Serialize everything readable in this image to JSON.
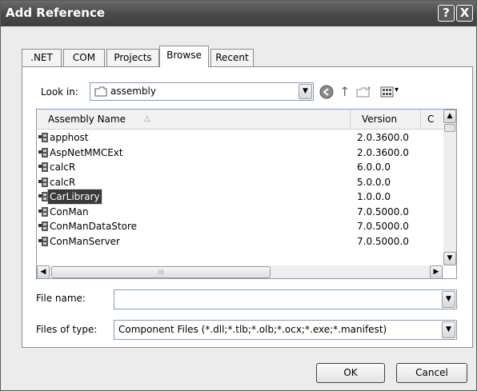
{
  "window": {
    "title": "Add Reference"
  },
  "tabs": [
    {
      "label": ".NET",
      "active": false
    },
    {
      "label": "COM",
      "active": false
    },
    {
      "label": "Projects",
      "active": false
    },
    {
      "label": "Browse",
      "active": true
    },
    {
      "label": "Recent",
      "active": false
    }
  ],
  "lookin": {
    "label": "Look in:",
    "value": "assembly"
  },
  "list": {
    "columns": [
      "Assembly Name",
      "Version",
      "C"
    ],
    "rows": [
      {
        "name": "apphost",
        "version": "2.0.3600.0",
        "selected": false
      },
      {
        "name": "AspNetMMCExt",
        "version": "2.0.3600.0",
        "selected": false
      },
      {
        "name": "calcR",
        "version": "6.0.0.0",
        "selected": false
      },
      {
        "name": "calcR",
        "version": "5.0.0.0",
        "selected": false
      },
      {
        "name": "CarLibrary",
        "version": "1.0.0.0",
        "selected": true
      },
      {
        "name": "ConMan",
        "version": "7.0.5000.0",
        "selected": false
      },
      {
        "name": "ConManDataStore",
        "version": "7.0.5000.0",
        "selected": false
      },
      {
        "name": "ConManServer",
        "version": "7.0.5000.0",
        "selected": false
      }
    ]
  },
  "filename": {
    "label": "File name:",
    "value": ""
  },
  "filetype": {
    "label": "Files of type:",
    "value": "Component Files (*.dll;*.tlb;*.olb;*.ocx;*.exe;*.manifest)"
  },
  "buttons": {
    "ok": "OK",
    "cancel": "Cancel"
  },
  "icons": {
    "help": "?",
    "close": "X",
    "up": "↑",
    "view_menu": "▾"
  },
  "colors": {
    "titlebar": "#4a4a4a",
    "selection": "#3a3a3a",
    "field_border": "#7f9db9"
  }
}
